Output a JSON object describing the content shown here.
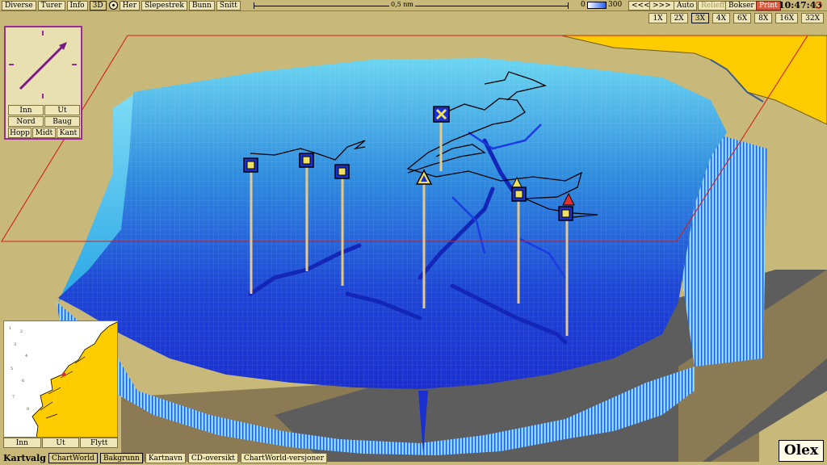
{
  "toolbar": {
    "menu": [
      "Diverse",
      "Turer",
      "Info"
    ],
    "mode_3d": "3D",
    "items_after": [
      "Her",
      "Slepestrek",
      "Bunn",
      "Snitt"
    ],
    "scale_label": "0,5 nm",
    "depth_min": "0",
    "depth_max": "300",
    "prev": "<<<",
    "next": ">>>",
    "auto": "Auto",
    "relieff": "Relieff",
    "bokser": "Bokser",
    "print": "Print",
    "clock": "10:47:43"
  },
  "zoom": {
    "options": [
      "1X",
      "2X",
      "3X",
      "4X",
      "6X",
      "8X",
      "16X",
      "32X"
    ],
    "selected": "3X"
  },
  "compass": {
    "heading_deg": 45,
    "buttons_row1": [
      "Inn",
      "Ut"
    ],
    "buttons_row2": [
      "Nord",
      "Baug"
    ],
    "buttons_row3": [
      "Hopp",
      "Midt",
      "Kant"
    ]
  },
  "minimap": {
    "buttons": [
      "Inn",
      "Ut",
      "Flytt"
    ]
  },
  "bottom": {
    "title": "Kartvalg",
    "buttons": [
      "ChartWorld",
      "Bakgrunn",
      "Kartnavn",
      "CD-oversikt",
      "ChartWorld-versjoner"
    ],
    "active": [
      "ChartWorld",
      "Bakgrunn"
    ]
  },
  "brand": "Olex",
  "colors": {
    "panel": "#c8b97a",
    "water_deep": "#1a2fd0",
    "water_shallow": "#5fd0f0",
    "land": "#ffcc00",
    "print_button": "#e25a3c",
    "compass_frame": "#9a2a9a"
  }
}
